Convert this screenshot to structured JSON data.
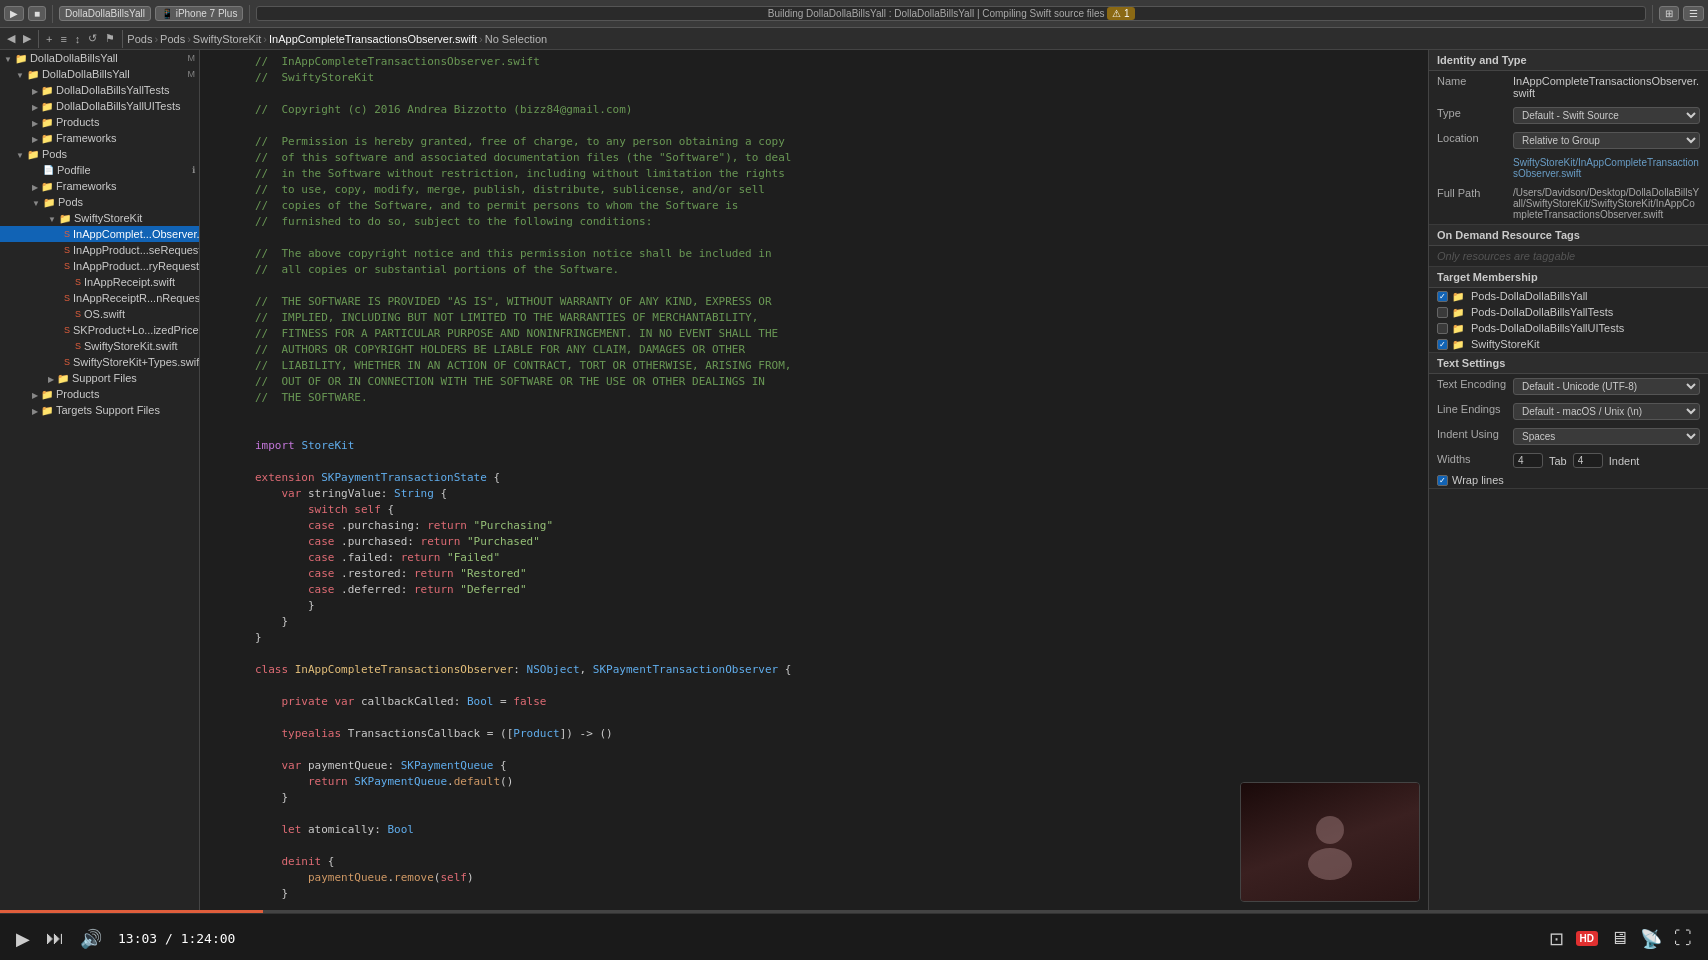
{
  "app": {
    "title": "DollaDollaBillsYall",
    "device": "iPhone 7 Plus",
    "window_title": "Building DollaDollaBillsYall : DollaDollaBillsYall | Compiling Swift source files",
    "warning_count": "1"
  },
  "breadcrumb": {
    "items": [
      "Pods",
      "Pods",
      "SwiftyStoreKit",
      "InAppCompleteTransactionsObserver.swift",
      "No Selection"
    ]
  },
  "sidebar": {
    "items": [
      {
        "label": "DollaDollaBillsYall",
        "indent": 0,
        "type": "project",
        "open": true,
        "m": "M"
      },
      {
        "label": "DollaDollaBillsYall",
        "indent": 1,
        "type": "folder",
        "open": true,
        "m": "M"
      },
      {
        "label": "DollaDollaBillsYallTests",
        "indent": 2,
        "type": "folder",
        "open": false
      },
      {
        "label": "DollaDollaBillsYallUITests",
        "indent": 2,
        "type": "folder",
        "open": false
      },
      {
        "label": "Products",
        "indent": 2,
        "type": "folder",
        "open": false
      },
      {
        "label": "Frameworks",
        "indent": 2,
        "type": "folder",
        "open": false
      },
      {
        "label": "Pods",
        "indent": 1,
        "type": "folder",
        "open": true
      },
      {
        "label": "Podfile",
        "indent": 2,
        "type": "file"
      },
      {
        "label": "Frameworks",
        "indent": 2,
        "type": "folder",
        "open": false
      },
      {
        "label": "Pods",
        "indent": 2,
        "type": "folder",
        "open": true
      },
      {
        "label": "SwiftyStoreKit",
        "indent": 3,
        "type": "folder",
        "open": true
      },
      {
        "label": "InAppComplet...Observer.swift",
        "indent": 4,
        "type": "swift",
        "selected": true
      },
      {
        "label": "InAppProduct...seRequest.swift",
        "indent": 4,
        "type": "swift"
      },
      {
        "label": "InAppProduct...ryRequest.swift",
        "indent": 4,
        "type": "swift"
      },
      {
        "label": "InAppReceipt.swift",
        "indent": 4,
        "type": "swift"
      },
      {
        "label": "InAppReceiptR...nRequest.swift",
        "indent": 4,
        "type": "swift"
      },
      {
        "label": "OS.swift",
        "indent": 4,
        "type": "swift"
      },
      {
        "label": "SKProduct+Lo...izedPrice.swift",
        "indent": 4,
        "type": "swift"
      },
      {
        "label": "SwiftyStoreKit.swift",
        "indent": 4,
        "type": "swift"
      },
      {
        "label": "SwiftyStoreKit+Types.swift",
        "indent": 4,
        "type": "swift"
      },
      {
        "label": "Support Files",
        "indent": 3,
        "type": "folder",
        "open": false
      },
      {
        "label": "Products",
        "indent": 2,
        "type": "folder",
        "open": false
      },
      {
        "label": "Targets Support Files",
        "indent": 2,
        "type": "folder",
        "open": false
      }
    ]
  },
  "identity_and_type": {
    "header": "Identity and Type",
    "name_label": "Name",
    "name_value": "InAppCompleteTransactionsObserver.swift",
    "type_label": "Type",
    "type_value": "Default - Swift Source",
    "location_label": "Location",
    "location_value": "Relative to Group",
    "path_label": "",
    "path_value": "SwiftyStoreKit/InAppCompleteTransactionsObserver.swift",
    "full_path_label": "Full Path",
    "full_path_value": "/Users/Davidson/Desktop/DollaDollaBillsYall/SwiftyStoreKit/SwiftyStoreKit/InAppCompleteTransactionsObserver.swift"
  },
  "on_demand": {
    "header": "On Demand Resource Tags",
    "placeholder": "Only resources are taggable"
  },
  "target_membership": {
    "header": "Target Membership",
    "items": [
      {
        "label": "Pods-DollaDollaBillsYall",
        "checked": true
      },
      {
        "label": "Pods-DollaDollaBillsYallTests",
        "checked": false
      },
      {
        "label": "Pods-DollaDollaBillsYallUITests",
        "checked": false
      },
      {
        "label": "SwiftyStoreKit",
        "checked": true
      }
    ]
  },
  "text_settings": {
    "header": "Text Settings",
    "encoding_label": "Text Encoding",
    "encoding_value": "Default - Unicode (UTF-8)",
    "line_endings_label": "Line Endings",
    "line_endings_value": "Default - macOS / Unix (\\n)",
    "indent_label": "Indent Using",
    "indent_value": "Spaces",
    "widths_label": "Widths",
    "tab_value": "4",
    "indent_value2": "4",
    "tab_label": "Tab",
    "indent_label2": "Indent",
    "wrap_lines": "Wrap lines",
    "wrap_checked": true
  },
  "video": {
    "current_time": "13:03",
    "total_time": "1:24:00",
    "progress_percent": 15.4
  },
  "code": {
    "filename": "InAppCompleteTransactionsObserver.swift"
  }
}
